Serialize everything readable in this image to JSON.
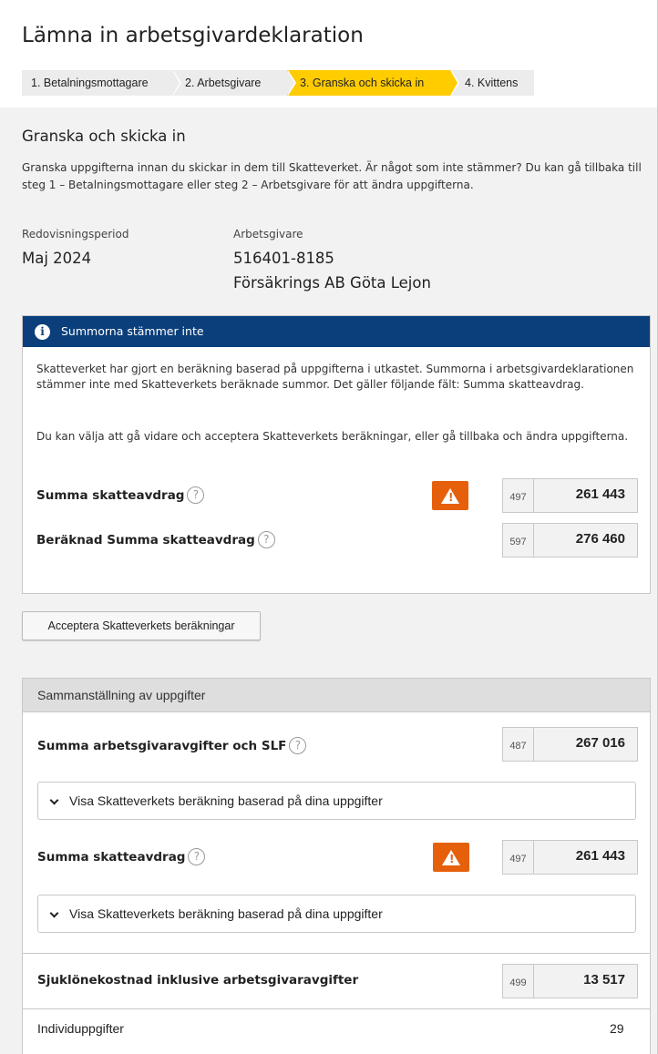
{
  "page_title": "Lämna in arbetsgivardeklaration",
  "steps": [
    {
      "label": "1. Betalningsmottagare"
    },
    {
      "label": "2. Arbetsgivare"
    },
    {
      "label": "3. Granska och skicka in",
      "active": true
    },
    {
      "label": "4. Kvittens"
    }
  ],
  "intro": {
    "title": "Granska och skicka in",
    "text": "Granska uppgifterna innan du skickar in dem till Skatteverket. Är något som inte stämmer? Du kan gå tillbaka till steg 1 – Betalningsmottagare eller steg 2 – Arbetsgivare för att ändra uppgifterna."
  },
  "period": {
    "label": "Redovisningsperiod",
    "value": "Maj 2024"
  },
  "employer": {
    "label": "Arbetsgivare",
    "org_number": "516401-8185",
    "name": "Försäkrings AB Göta Lejon"
  },
  "warning": {
    "title": "Summorna stämmer inte",
    "text1": "Skatteverket har gjort en beräkning baserad på uppgifterna i utkastet. Summorna i arbetsgivardeklarationen stämmer inte med Skatteverkets beräknade summor. Det gäller följande fält: Summa skatteavdrag.",
    "text2": "Du kan välja att gå vidare och acceptera Skatteverkets beräkningar, eller gå tillbaka och ändra uppgifterna.",
    "fields": [
      {
        "label": "Summa skatteavdrag",
        "code": "497",
        "value": "261 443",
        "alert": true
      },
      {
        "label": "Beräknad Summa skatteavdrag",
        "code": "597",
        "value": "276 460",
        "alert": false
      }
    ]
  },
  "accept_button": "Acceptera Skatteverkets beräkningar",
  "summary": {
    "title": "Sammanställning av uppgifter",
    "fields": [
      {
        "label": "Summa arbetsgivaravgifter och SLF",
        "code": "487",
        "value": "267 016",
        "expander": "Visa Skatteverkets beräkning baserad på dina uppgifter"
      },
      {
        "label": "Summa skatteavdrag",
        "code": "497",
        "value": "261 443",
        "expander": "Visa Skatteverkets beräkning baserad på dina uppgifter",
        "alert": true
      },
      {
        "label": "Sjuklönekostnad inklusive arbetsgivaravgifter",
        "code": "499",
        "value": "13 517"
      }
    ],
    "individ": {
      "label": "Individuppgifter",
      "value": "29"
    }
  },
  "help_glyph": "?",
  "colors": {
    "active_step": "#ffcc00",
    "info_header": "#0b3f7c",
    "alert": "#e6600b"
  }
}
